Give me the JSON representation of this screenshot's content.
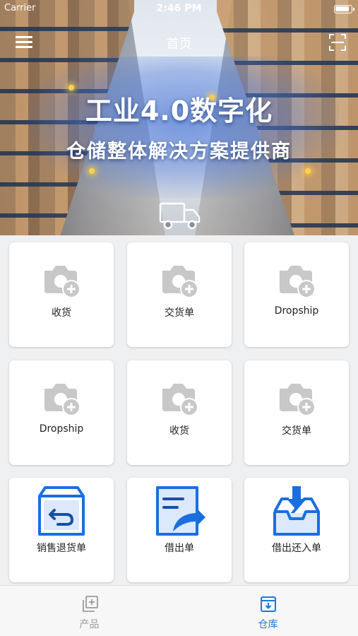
{
  "status_bar": {
    "carrier": "Carrier",
    "time": "2:46 PM"
  },
  "nav": {
    "title": "首页"
  },
  "banner": {
    "title": "工业4.0数字化",
    "subtitle": "仓储整体解决方案提供商"
  },
  "grid": {
    "items": [
      {
        "label": "收货",
        "icon": "camera-add-icon"
      },
      {
        "label": "交货单",
        "icon": "camera-add-icon"
      },
      {
        "label": "Dropship",
        "icon": "camera-add-icon"
      },
      {
        "label": "Dropship",
        "icon": "camera-add-icon"
      },
      {
        "label": "收货",
        "icon": "camera-add-icon"
      },
      {
        "label": "交货单",
        "icon": "camera-add-icon"
      },
      {
        "label": "销售退货单",
        "icon": "return-box-icon"
      },
      {
        "label": "借出单",
        "icon": "lend-document-icon"
      },
      {
        "label": "借出还入单",
        "icon": "inbox-download-icon"
      }
    ]
  },
  "tab_bar": {
    "tabs": [
      {
        "label": "产品",
        "icon": "add-square-icon",
        "active": false
      },
      {
        "label": "仓库",
        "icon": "warehouse-box-icon",
        "active": true
      }
    ]
  },
  "colors": {
    "accent": "#1f78d9",
    "icon_blue": "#1a6fe0",
    "placeholder_gray": "#c8c8c8"
  }
}
